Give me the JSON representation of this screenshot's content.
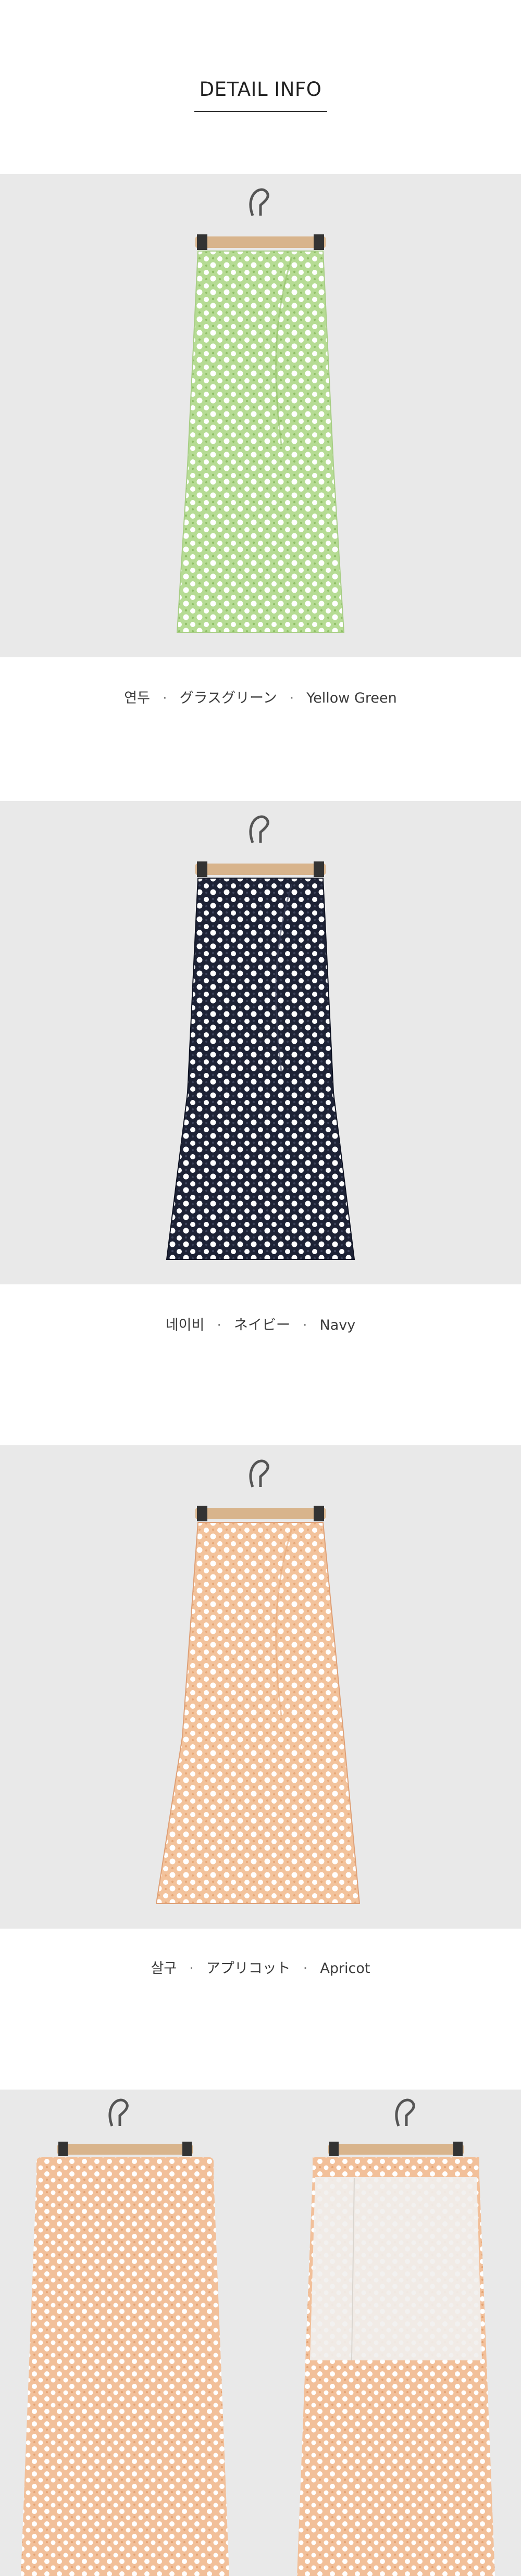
{
  "header": {
    "title": "DETAIL INFO"
  },
  "colors": [
    {
      "kr": "연두",
      "jp": "グラスグリーン",
      "en": "Yellow Green",
      "base": "#b6dc94",
      "dot": "#ffffff",
      "accent": "#8fbf66"
    },
    {
      "kr": "네이비",
      "jp": "ネイビー",
      "en": "Navy",
      "base": "#1d2235",
      "dot": "#ffffff",
      "accent": "#3a4058"
    },
    {
      "kr": "살구",
      "jp": "アプリコット",
      "en": "Apricot",
      "base": "#f3c39c",
      "dot": "#ffffff",
      "accent": "#e7a878"
    }
  ],
  "separator": "·",
  "detail_views": [
    {
      "view": "front-waistband",
      "base": "#f2c09a"
    },
    {
      "view": "inner-lining",
      "base": "#f2c09a",
      "lining": "#f1f0ee"
    }
  ]
}
